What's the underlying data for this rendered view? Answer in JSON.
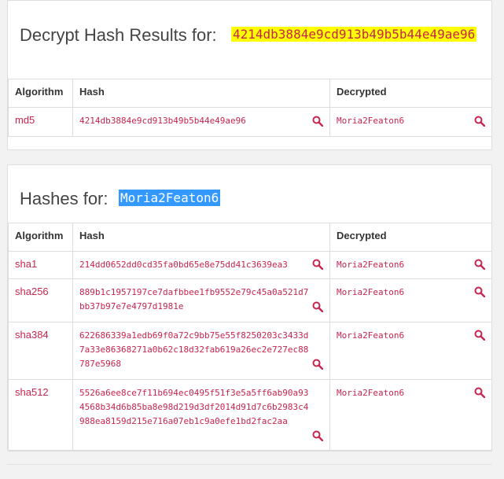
{
  "decrypt_panel": {
    "title": "Decrypt Hash Results for:",
    "hash": "4214db3884e9cd913b49b5b44e49ae96",
    "headers": {
      "algorithm": "Algorithm",
      "hash": "Hash",
      "decrypted": "Decrypted"
    },
    "rows": [
      {
        "algorithm": "md5",
        "hash": "4214db3884e9cd913b49b5b44e49ae96",
        "decrypted": "Moria2Featon6"
      }
    ]
  },
  "hashes_panel": {
    "title": "Hashes for:",
    "word": "Moria2Featon6",
    "headers": {
      "algorithm": "Algorithm",
      "hash": "Hash",
      "decrypted": "Decrypted"
    },
    "rows": [
      {
        "algorithm": "sha1",
        "hash": "214dd0652dd0cd35fa0bd65e8e75dd41c3639ea3",
        "decrypted": "Moria2Featon6"
      },
      {
        "algorithm": "sha256",
        "hash": "889b1c1957197ce7dafbbee1fb9552e79c45a0a521d7bb37b97e7e4797d1981e",
        "decrypted": "Moria2Featon6"
      },
      {
        "algorithm": "sha384",
        "hash": "622686339a1edb69f0a72c9bb75e55f8250203c3433d7a33e86368271a0b62c18d32fab619a26ec2e727ec88787e5968",
        "decrypted": "Moria2Featon6"
      },
      {
        "algorithm": "sha512",
        "hash": "5526a6ee8ce7f11b694ec0495f51f3e5a5ff6ab90a934568b34d6b85ba8e98d219d3df2014d91d7c6b2983c4988ea8159d215e716a07eb1c9a0efe1bd2fac2aa",
        "decrypted": "Moria2Featon6"
      }
    ]
  },
  "icons": {
    "search": "search-icon"
  },
  "colors": {
    "code": "#c7254e",
    "highlight_yellow": "#ffff00",
    "selection_blue": "#3399ff",
    "title": "#444444"
  }
}
